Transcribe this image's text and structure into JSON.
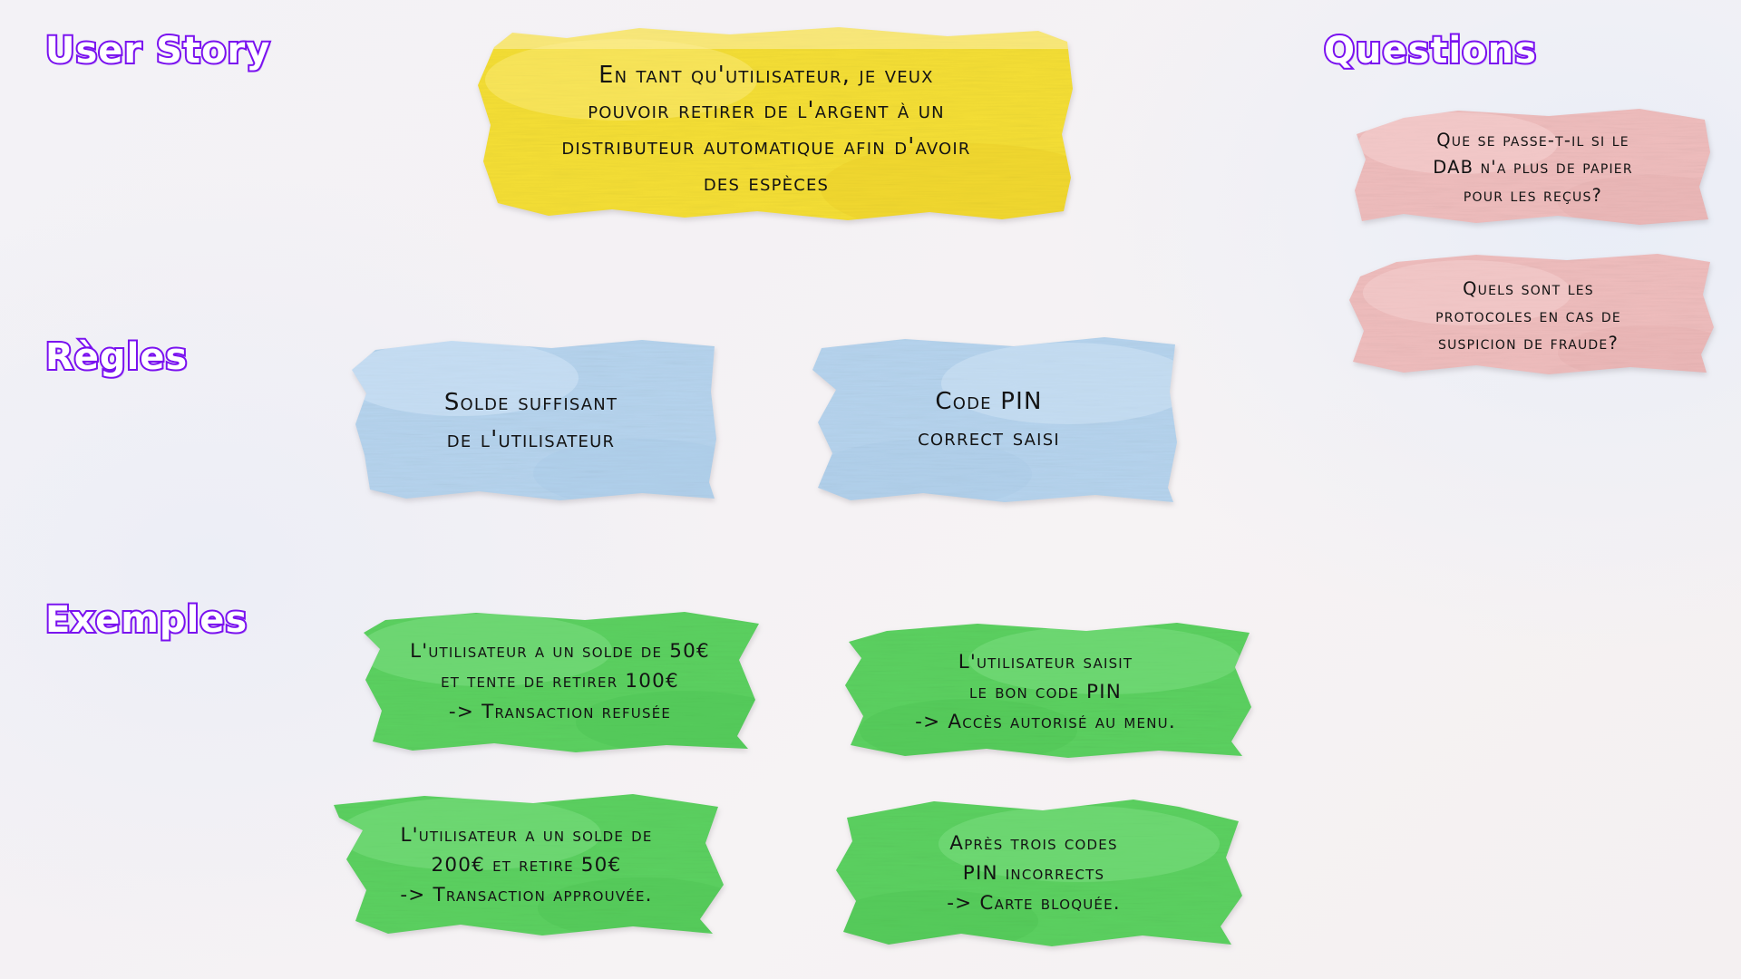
{
  "board": {
    "background_color": "#f4f1f4",
    "heading_fill_color": "#ffffff",
    "heading_outline_color": "#7a12f0"
  },
  "sections": {
    "user_story": {
      "heading": "User Story"
    },
    "regles": {
      "heading": "Règles"
    },
    "exemples": {
      "heading": "Exemples"
    },
    "questions": {
      "heading": "Questions"
    }
  },
  "notes": {
    "user_story": {
      "color": "#f5df35",
      "color_name": "yellow",
      "text": "En tant qu'utilisateur, je veux\npouvoir retirer de l'argent à un\ndistributeur automatique afin d'avoir\ndes espèces"
    },
    "questions": [
      {
        "color": "#efbdbd",
        "color_name": "pink",
        "text": "Que se passe-t-il si le\nDAB n'a plus de papier\npour les reçus?"
      },
      {
        "color": "#efbdbd",
        "color_name": "pink",
        "text": "Quels sont les\nprotocoles en cas de\nsuspicion de fraude?"
      }
    ],
    "rules": [
      {
        "color": "#b6d4ee",
        "color_name": "blue",
        "text": "Solde suffisant\nde l'utilisateur"
      },
      {
        "color": "#b6d4ee",
        "color_name": "blue",
        "text": "Code PIN\ncorrect saisi"
      }
    ],
    "examples": [
      {
        "color": "#5bd160",
        "color_name": "green",
        "text": "L'utilisateur a un solde de 50€\net tente de retirer 100€\n-> Transaction refusée"
      },
      {
        "color": "#5bd160",
        "color_name": "green",
        "text": "L'utilisateur saisit\nle bon code PIN\n-> Accès autorisé au menu."
      },
      {
        "color": "#5bd160",
        "color_name": "green",
        "text": "L'utilisateur a un solde de\n200€ et retire 50€\n-> Transaction approuvée."
      },
      {
        "color": "#5bd160",
        "color_name": "green",
        "text": "Après trois codes\nPIN incorrects\n-> Carte bloquée."
      }
    ]
  }
}
